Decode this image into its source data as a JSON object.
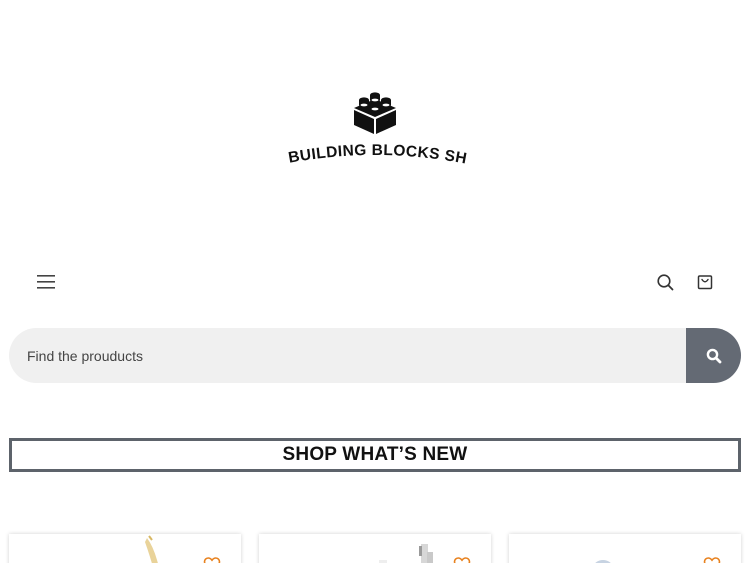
{
  "brand": {
    "name": "MY BUILDING BLOCKS SHOP"
  },
  "header": {
    "menu_icon": "hamburger-menu-icon",
    "search_icon": "search-icon",
    "cart_icon": "shopping-bag-icon"
  },
  "search": {
    "placeholder": "Find the prouducts",
    "value": "",
    "button_icon": "search-icon"
  },
  "section": {
    "title": "SHOP WHAT’S NEW"
  },
  "products": [
    {
      "image": "product-image",
      "favorite_icon": "heart-icon"
    },
    {
      "image": "product-image",
      "favorite_icon": "heart-icon"
    },
    {
      "image": "product-image",
      "favorite_icon": "heart-icon"
    }
  ],
  "colors": {
    "search_button": "#646a74",
    "search_bg": "#f0f0f0",
    "title_border": "#5d636b",
    "favorite": "#e8821f"
  }
}
